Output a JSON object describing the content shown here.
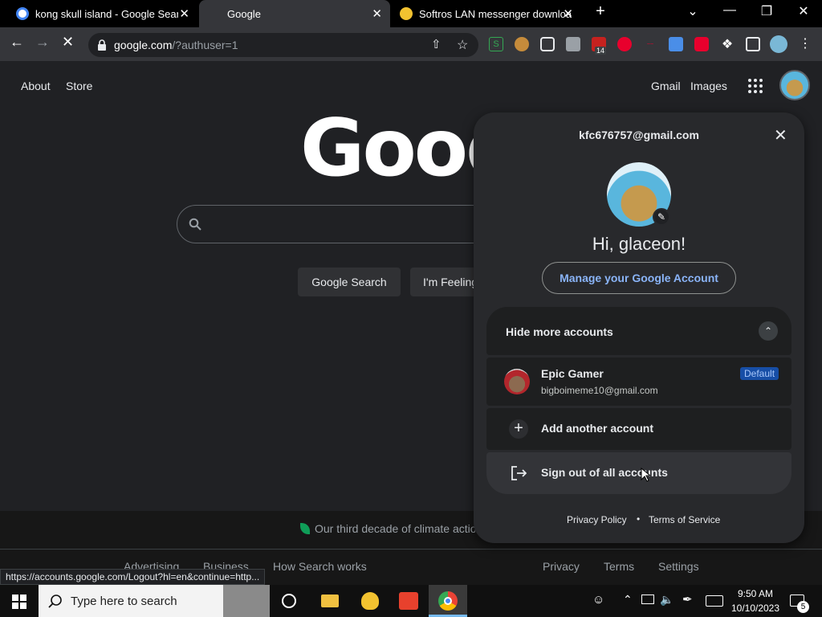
{
  "tabs": [
    {
      "title": "kong skull island - Google Search",
      "close": "✕"
    },
    {
      "title": "Google",
      "close": "✕"
    },
    {
      "title": "Softros LAN messenger download",
      "close": "✕"
    }
  ],
  "new_tab": "+",
  "window_controls": {
    "dropdown": "⌄",
    "minimize": "—",
    "restore": "❐",
    "close": "✕"
  },
  "omnibox": {
    "host": "google.com",
    "path": "/?authuser=1"
  },
  "extensions": [
    "S",
    "14"
  ],
  "header": {
    "about": "About",
    "store": "Store",
    "gmail": "Gmail",
    "images": "Images"
  },
  "logo_text": "Google",
  "buttons": {
    "search": "Google Search",
    "lucky": "I'm Feeling"
  },
  "footer": {
    "climate": "Our third decade of climate actio",
    "advertising": "Advertising",
    "business": "Business",
    "how": "How Search works",
    "privacy": "Privacy",
    "terms": "Terms",
    "settings": "Settings"
  },
  "account": {
    "email": "kfc676757@gmail.com",
    "greeting": "Hi, glaceon!",
    "manage": "Manage your Google Account",
    "hide_more": "Hide more accounts",
    "other_name": "Epic Gamer",
    "other_email": "bigboimeme10@gmail.com",
    "default_badge": "Default",
    "add_account": "Add another account",
    "sign_out": "Sign out of all accounts",
    "privacy_policy": "Privacy Policy",
    "dot": "•",
    "terms_of_service": "Terms of Service"
  },
  "status_url": "https://accounts.google.com/Logout?hl=en&continue=http...",
  "taskbar": {
    "search_placeholder": "Type here to search",
    "time": "9:50 AM",
    "date": "10/10/2023",
    "notifications": "5"
  },
  "colors": {
    "default_badge_bg": "#174ea6",
    "link_blue": "#8ab4f8",
    "accent_red": "#e8002d"
  }
}
